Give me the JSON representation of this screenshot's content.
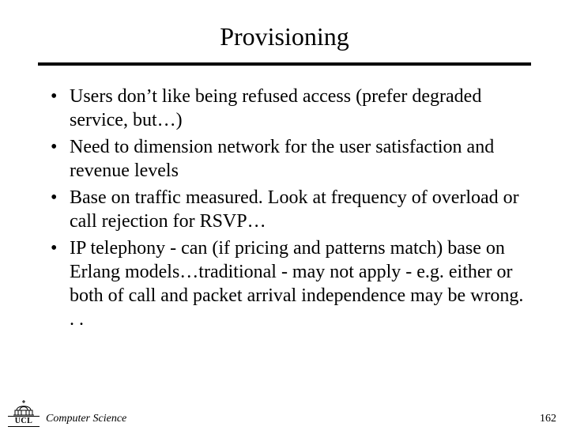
{
  "title": "Provisioning",
  "bullets": [
    "Users don’t like being refused access (prefer degraded service, but…)",
    "Need to dimension network for the user satisfaction and revenue levels",
    "Base on traffic measured. Look at frequency of overload or call rejection for RSVP…",
    "IP telephony - can (if pricing and patterns match) base on Erlang models…traditional - may not apply - e.g. either or both of call and packet arrival independence may be wrong. . ."
  ],
  "footer": {
    "logo_text": "UCL",
    "department": "Computer Science",
    "page_number": "162"
  }
}
